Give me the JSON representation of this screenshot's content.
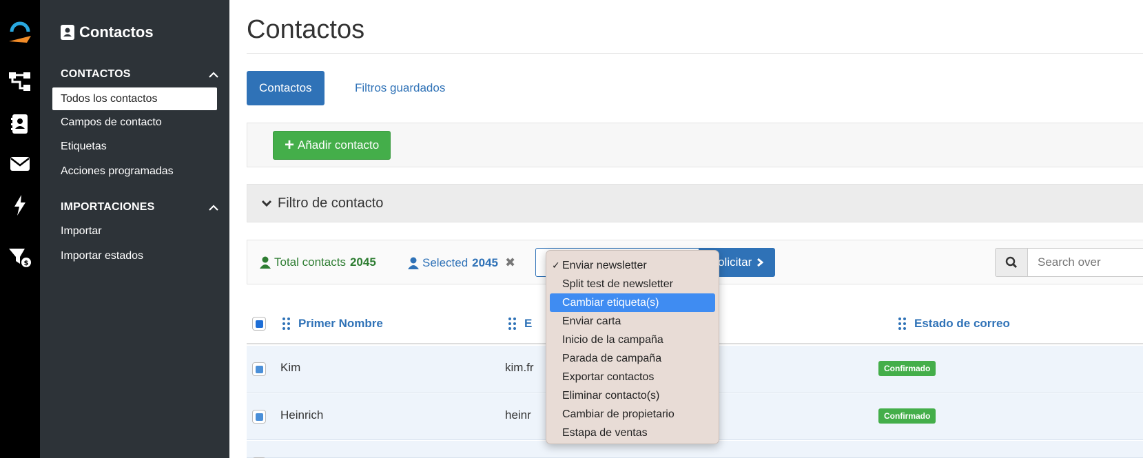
{
  "colors": {
    "rail": "#000000",
    "sidebar": "#2d3338",
    "primary": "#2f72b7",
    "success": "#44ae4a",
    "highlight": "#3f8cf2",
    "dropdown_bg": "#e8dcd6"
  },
  "rail": {
    "icons": [
      "brand-logo-icon",
      "workflow-icon",
      "contacts-book-icon",
      "envelope-icon",
      "lightning-icon",
      "cart-dollar-icon"
    ]
  },
  "sidebar": {
    "title": "Contactos",
    "sections": [
      {
        "label": "CONTACTOS",
        "items": [
          "Todos los contactos",
          "Campos de contacto",
          "Etiquetas",
          "Acciones programadas"
        ]
      },
      {
        "label": "IMPORTACIONES",
        "items": [
          "Importar",
          "Importar estados"
        ]
      }
    ],
    "active_item": "Todos los contactos"
  },
  "main": {
    "title": "Contactos",
    "tabs": [
      {
        "label": "Contactos",
        "active": true
      },
      {
        "label": "Filtros guardados",
        "active": false
      }
    ],
    "add_button": "Añadir contacto",
    "filter_label": "Filtro de contacto",
    "bulk": {
      "total_label": "Total contacts",
      "total_value": "2045",
      "selected_label": "Selected",
      "selected_value": "2045",
      "apply_label": "Solicitar",
      "search_placeholder": "Search over"
    },
    "table": {
      "columns": [
        "Primer Nombre",
        "E",
        "Estado de correo"
      ],
      "rows": [
        {
          "first_name": "Kim",
          "email_fragment": "kim.fr",
          "status": "Confirmado"
        },
        {
          "first_name": "Heinrich",
          "email_fragment": "heinr",
          "status": "Confirmado"
        }
      ]
    }
  },
  "dropdown": {
    "selected": "Enviar newsletter",
    "highlighted": "Cambiar etiqueta(s)",
    "options": [
      "Enviar newsletter",
      "Split test de newsletter",
      "Cambiar etiqueta(s)",
      "Enviar carta",
      "Inicio de la campaña",
      "Parada de campaña",
      "Exportar contactos",
      "Eliminar contacto(s)",
      "Cambiar de propietario",
      "Estapa de ventas"
    ]
  }
}
